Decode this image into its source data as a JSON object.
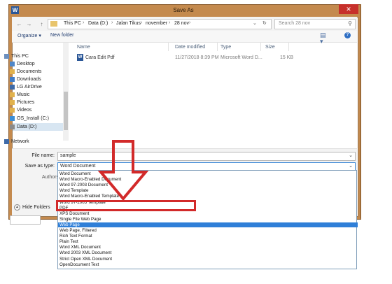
{
  "window": {
    "title": "Save As",
    "app_icon_letter": "W",
    "close_glyph": "✕"
  },
  "address": {
    "back_glyph": "←",
    "forward_glyph": "→",
    "up_glyph": "↑",
    "breadcrumbs": [
      "This PC",
      "Data (D:)",
      "Jalan Tikus",
      "november",
      "28 nov"
    ],
    "separator": "›",
    "refresh_glyph": "↻",
    "dropdown_glyph": "⌄"
  },
  "search": {
    "placeholder": "Search 28 nov",
    "icon_glyph": "⚲"
  },
  "toolbar": {
    "organize": "Organize ▾",
    "new_folder": "New folder",
    "view_glyph": "▤ ▾",
    "help_glyph": "?"
  },
  "nav_pane": {
    "items": [
      {
        "label": "This PC",
        "icon": "computer-icon",
        "color": "#6b8fbf"
      },
      {
        "label": "Desktop",
        "icon": "desktop-icon",
        "color": "#4f87c9"
      },
      {
        "label": "Documents",
        "icon": "documents-icon",
        "color": "#e1b24d"
      },
      {
        "label": "Downloads",
        "icon": "downloads-icon",
        "color": "#3f7cc8"
      },
      {
        "label": "LG AirDrive",
        "icon": "drive-icon",
        "color": "#3e6aa8"
      },
      {
        "label": "Music",
        "icon": "music-icon",
        "color": "#e1b24d"
      },
      {
        "label": "Pictures",
        "icon": "pictures-icon",
        "color": "#e1b24d"
      },
      {
        "label": "Videos",
        "icon": "videos-icon",
        "color": "#e1b24d"
      },
      {
        "label": "OS_Install (C:)",
        "icon": "windows-drive-icon",
        "color": "#3a8ed6"
      },
      {
        "label": "Data (D:)",
        "icon": "drive-icon",
        "color": "#8a8a8a"
      }
    ],
    "network": {
      "label": "Network",
      "icon": "network-icon",
      "color": "#3e6aa8"
    }
  },
  "file_list": {
    "columns": [
      "Name",
      "Date modified",
      "Type",
      "Size"
    ],
    "rows": [
      {
        "name": "Cara Edit Pdf",
        "date": "11/27/2018 8:39 PM",
        "type": "Microsoft Word D...",
        "size": "15 KB"
      }
    ]
  },
  "form": {
    "filename_label": "File name:",
    "filename_value": "sample",
    "saveas_label": "Save as type:",
    "saveas_value": "Word Document",
    "authors_label": "Authors",
    "hide_folders": "Hide Folders",
    "chevron": "⌄"
  },
  "dropdown": {
    "selected_index": 9,
    "options": [
      "Word Document",
      "Word Macro-Enabled Document",
      "Word 97-2003 Document",
      "Word Template",
      "Word Macro-Enabled Template",
      "Word 97-2003 Template",
      "PDF",
      "XPS Document",
      "Single File Web Page",
      "Web Page",
      "Web Page, Filtered",
      "Rich Text Format",
      "Plain Text",
      "Word XML Document",
      "Word 2003 XML Document",
      "Strict Open XML Document",
      "OpenDocument Text"
    ]
  },
  "annotation": {
    "color": "#d22a2a"
  }
}
